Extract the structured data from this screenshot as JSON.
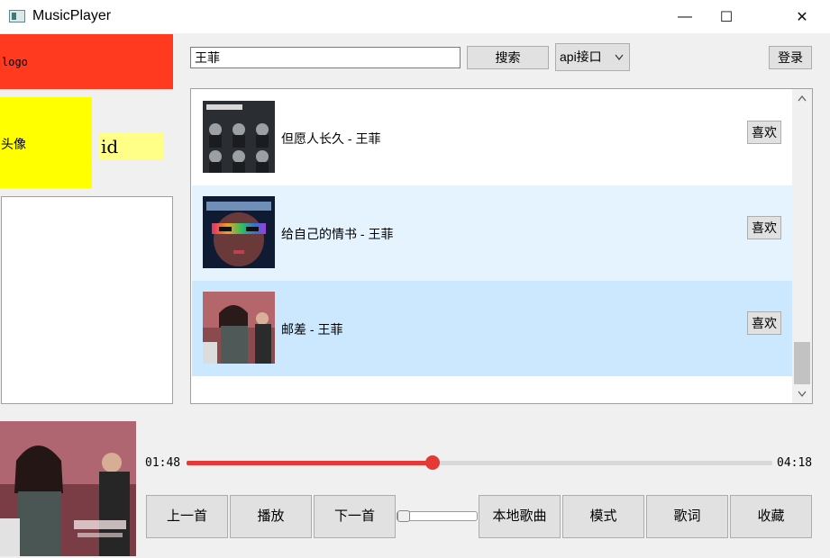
{
  "window": {
    "title": "MusicPlayer",
    "minimize_glyph": "—",
    "maximize_glyph": "☐",
    "close_glyph": "✕"
  },
  "sidebar": {
    "logo_text": "logo",
    "avatar_text": "头像",
    "id_text": "id"
  },
  "search": {
    "query": "王菲",
    "button_label": "搜索",
    "api_selected": "api接口",
    "login_label": "登录"
  },
  "songs": [
    {
      "title": "但愿人长久 - 王菲",
      "like_label": "喜欢",
      "row_color": "#ffffff"
    },
    {
      "title": "给自己的情书 - 王菲",
      "like_label": "喜欢",
      "row_color": "#e5f3ff"
    },
    {
      "title": "邮差 - 王菲",
      "like_label": "喜欢",
      "row_color": "#cce8ff"
    }
  ],
  "player": {
    "elapsed": "01:48",
    "total": "04:18",
    "progress_fraction": 0.42,
    "volume_fraction": 0.0,
    "controls": {
      "prev": "上一首",
      "play": "播放",
      "next": "下一首",
      "local": "本地歌曲",
      "mode": "模式",
      "lyrics": "歌词",
      "favorites": "收藏"
    }
  },
  "colors": {
    "accent": "#e53935",
    "logo_bg": "#ff3a1f",
    "avatar_bg": "#ffff00",
    "id_bg": "#ffff88"
  }
}
